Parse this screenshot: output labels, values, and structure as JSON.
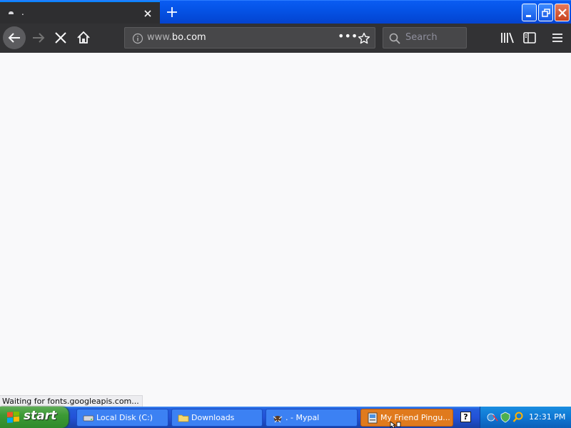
{
  "browser": {
    "tab": {
      "title": ".",
      "favicon": "dot-icon"
    },
    "toolbar": {
      "url_prefix": "www.",
      "url_domain": "bo.com",
      "page_actions_label": "•••",
      "search_placeholder": "Search"
    },
    "status_text": "Waiting for fonts.googleapis.com..."
  },
  "taskbar": {
    "start_label": "start",
    "tasks": [
      {
        "label": "Local Disk (C:)",
        "icon": "drive-icon"
      },
      {
        "label": "Downloads",
        "icon": "folder-icon"
      },
      {
        "label": ". - Mypal",
        "icon": "mypal-icon"
      },
      {
        "label": "My Friend Pingu...",
        "icon": "app-icon"
      }
    ],
    "help_label": "?",
    "clock": "12:31 PM"
  }
}
